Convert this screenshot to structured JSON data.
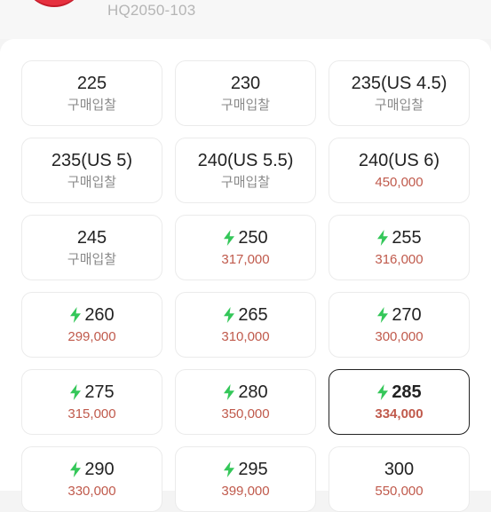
{
  "product": {
    "model_code": "HQ2050-103"
  },
  "colors": {
    "price_red": "#c05a4c",
    "muted_gray": "#8a8a8a",
    "bolt_green": "#34c759",
    "selected_border": "#222222"
  },
  "sizes": [
    {
      "size": "225",
      "price": "구매입찰",
      "express": false,
      "selected": false,
      "muted": true
    },
    {
      "size": "230",
      "price": "구매입찰",
      "express": false,
      "selected": false,
      "muted": true
    },
    {
      "size": "235(US 4.5)",
      "price": "구매입찰",
      "express": false,
      "selected": false,
      "muted": true
    },
    {
      "size": "235(US 5)",
      "price": "구매입찰",
      "express": false,
      "selected": false,
      "muted": true
    },
    {
      "size": "240(US 5.5)",
      "price": "구매입찰",
      "express": false,
      "selected": false,
      "muted": true
    },
    {
      "size": "240(US 6)",
      "price": "450,000",
      "express": false,
      "selected": false,
      "muted": false
    },
    {
      "size": "245",
      "price": "구매입찰",
      "express": false,
      "selected": false,
      "muted": true
    },
    {
      "size": "250",
      "price": "317,000",
      "express": true,
      "selected": false,
      "muted": false
    },
    {
      "size": "255",
      "price": "316,000",
      "express": true,
      "selected": false,
      "muted": false
    },
    {
      "size": "260",
      "price": "299,000",
      "express": true,
      "selected": false,
      "muted": false
    },
    {
      "size": "265",
      "price": "310,000",
      "express": true,
      "selected": false,
      "muted": false
    },
    {
      "size": "270",
      "price": "300,000",
      "express": true,
      "selected": false,
      "muted": false
    },
    {
      "size": "275",
      "price": "315,000",
      "express": true,
      "selected": false,
      "muted": false
    },
    {
      "size": "280",
      "price": "350,000",
      "express": true,
      "selected": false,
      "muted": false
    },
    {
      "size": "285",
      "price": "334,000",
      "express": true,
      "selected": true,
      "muted": false
    },
    {
      "size": "290",
      "price": "330,000",
      "express": true,
      "selected": false,
      "muted": false
    },
    {
      "size": "295",
      "price": "399,000",
      "express": true,
      "selected": false,
      "muted": false
    },
    {
      "size": "300",
      "price": "550,000",
      "express": false,
      "selected": false,
      "muted": false
    }
  ]
}
